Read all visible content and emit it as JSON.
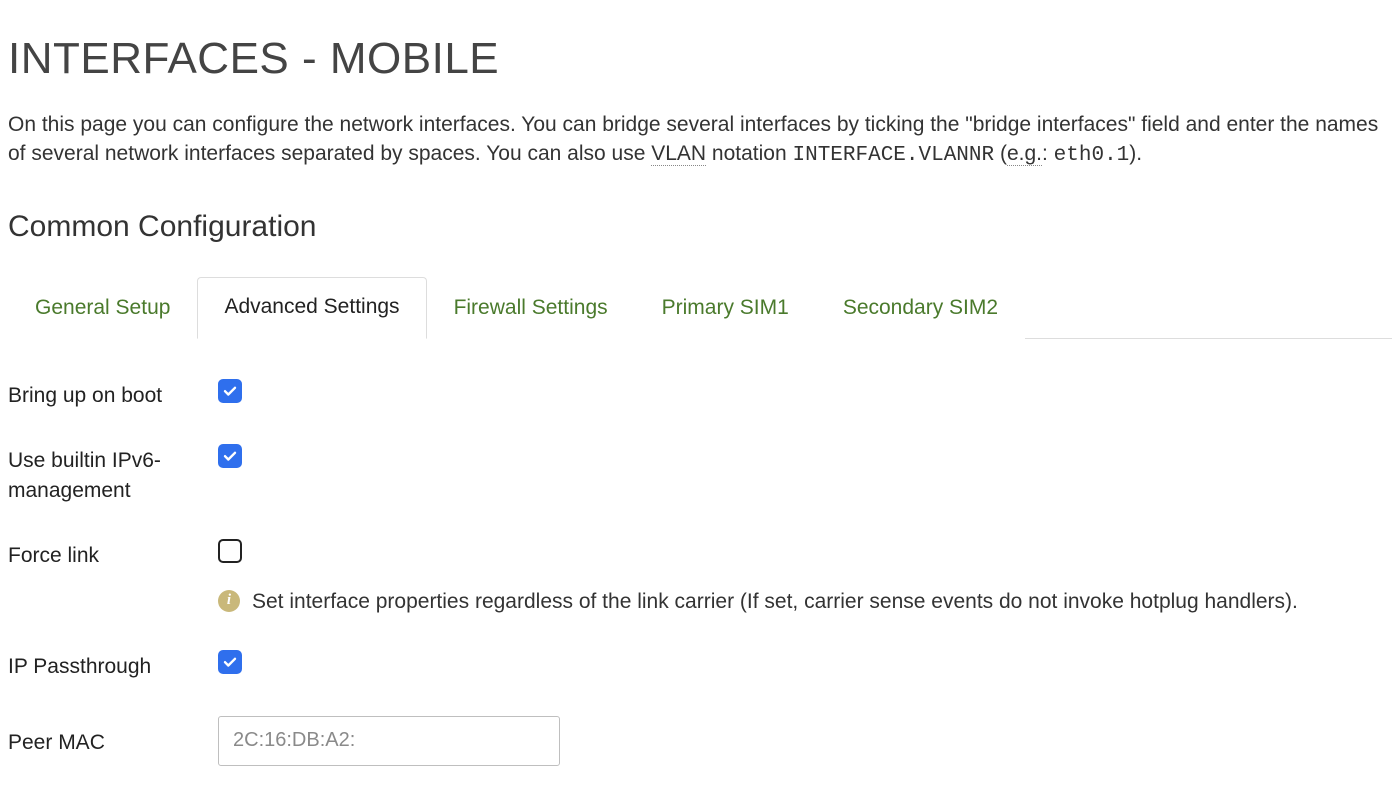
{
  "page_title": "INTERFACES - MOBILE",
  "intro": {
    "part1": "On this page you can configure the network interfaces. You can bridge several interfaces by ticking the \"bridge interfaces\" field and enter the names of several network interfaces separated by spaces. You can also use ",
    "vlan_abbr": "VLAN",
    "part2": " notation ",
    "notation": "INTERFACE.VLANNR",
    "part3": " (",
    "eg_abbr": "e.g.",
    "part4": ": ",
    "example": "eth0.1",
    "part5": ")."
  },
  "section_title": "Common Configuration",
  "tabs": [
    {
      "id": "general",
      "label": "General Setup",
      "active": false
    },
    {
      "id": "advanced",
      "label": "Advanced Settings",
      "active": true
    },
    {
      "id": "firewall",
      "label": "Firewall Settings",
      "active": false
    },
    {
      "id": "sim1",
      "label": "Primary SIM1",
      "active": false
    },
    {
      "id": "sim2",
      "label": "Secondary SIM2",
      "active": false
    }
  ],
  "fields": {
    "bring_up_on_boot": {
      "label": "Bring up on boot",
      "checked": true
    },
    "use_ipv6": {
      "label": "Use builtin IPv6-management",
      "checked": true
    },
    "force_link": {
      "label": "Force link",
      "checked": false,
      "help": "Set interface properties regardless of the link carrier (If set, carrier sense events do not invoke hotplug handlers)."
    },
    "ip_passthrough": {
      "label": "IP Passthrough",
      "checked": true
    },
    "peer_mac": {
      "label": "Peer MAC",
      "value": "2C:16:DB:A2:"
    }
  }
}
